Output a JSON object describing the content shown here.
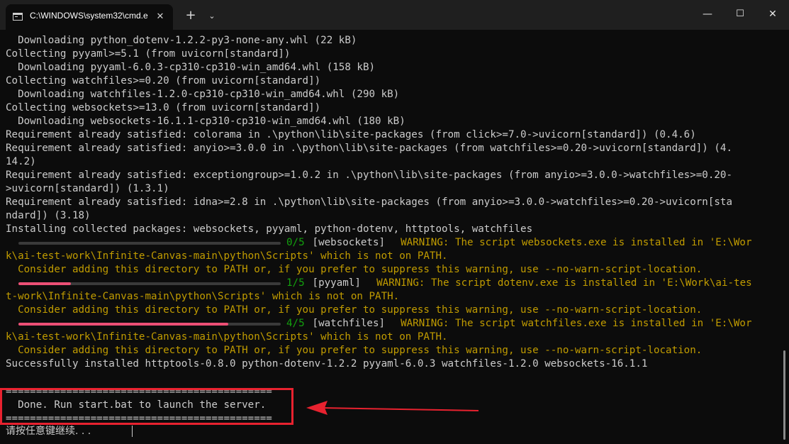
{
  "window": {
    "tab_title": "C:\\WINDOWS\\system32\\cmd.e",
    "tab_icon": "cmd-icon",
    "close_tab": "✕",
    "new_tab": "+",
    "dropdown": "⌄",
    "minimize": "—",
    "maximize": "☐",
    "close": "✕"
  },
  "colors": {
    "background": "#0c0c0c",
    "text": "#cccccc",
    "warning": "#c19c00",
    "success": "#13a10e",
    "progress": "#ec4f75",
    "annotation": "#e8222f"
  },
  "terminal": {
    "lines": [
      "  Downloading python_dotenv-1.2.2-py3-none-any.whl (22 kB)",
      "Collecting pyyaml>=5.1 (from uvicorn[standard])",
      "  Downloading pyyaml-6.0.3-cp310-cp310-win_amd64.whl (158 kB)",
      "Collecting watchfiles>=0.20 (from uvicorn[standard])",
      "  Downloading watchfiles-1.2.0-cp310-cp310-win_amd64.whl (290 kB)",
      "Collecting websockets>=13.0 (from uvicorn[standard])",
      "  Downloading websockets-16.1.1-cp310-cp310-win_amd64.whl (180 kB)",
      "Requirement already satisfied: colorama in .\\python\\lib\\site-packages (from click>=7.0->uvicorn[standard]) (0.4.6)",
      "Requirement already satisfied: anyio>=3.0.0 in .\\python\\lib\\site-packages (from watchfiles>=0.20->uvicorn[standard]) (4.",
      "14.2)",
      "Requirement already satisfied: exceptiongroup>=1.0.2 in .\\python\\lib\\site-packages (from anyio>=3.0.0->watchfiles>=0.20-",
      ">uvicorn[standard]) (1.3.1)",
      "Requirement already satisfied: idna>=2.8 in .\\python\\lib\\site-packages (from anyio>=3.0.0->watchfiles>=0.20->uvicorn[sta",
      "ndard]) (3.18)",
      "Installing collected packages: websockets, pyyaml, python-dotenv, httptools, watchfiles"
    ],
    "progress": [
      {
        "count": "0/5",
        "package": " [websockets]",
        "fraction": 0.0,
        "warning": "  WARNING: The script websockets.exe is installed in 'E:\\Wor",
        "cont": "k\\ai-test-work\\Infinite-Canvas-main\\python\\Scripts' which is not on PATH.",
        "hint": "  Consider adding this directory to PATH or, if you prefer to suppress this warning, use --no-warn-script-location."
      },
      {
        "count": "1/5",
        "package": " [pyyaml]",
        "fraction": 0.2,
        "warning": "  WARNING: The script dotenv.exe is installed in 'E:\\Work\\ai-tes",
        "cont": "t-work\\Infinite-Canvas-main\\python\\Scripts' which is not on PATH.",
        "hint": "  Consider adding this directory to PATH or, if you prefer to suppress this warning, use --no-warn-script-location."
      },
      {
        "count": "4/5",
        "package": " [watchfiles]",
        "fraction": 0.8,
        "warning": "  WARNING: The script watchfiles.exe is installed in 'E:\\Wor",
        "cont": "k\\ai-test-work\\Infinite-Canvas-main\\python\\Scripts' which is not on PATH.",
        "hint": "  Consider adding this directory to PATH or, if you prefer to suppress this warning, use --no-warn-script-location."
      }
    ],
    "success": "Successfully installed httptools-0.8.0 python-dotenv-1.2.2 pyyaml-6.0.3 watchfiles-1.2.0 websockets-16.1.1",
    "separator": "============================================",
    "done": "  Done. Run start.bat to launch the server.",
    "prompt": "请按任意键继续. . ."
  }
}
